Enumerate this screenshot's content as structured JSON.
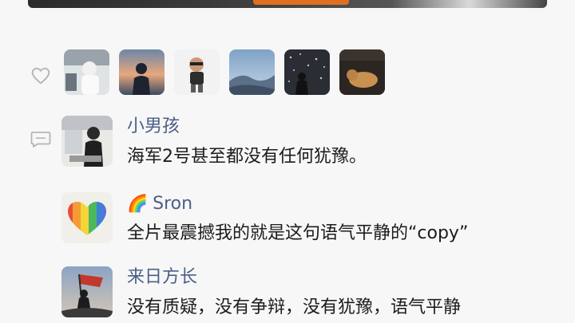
{
  "likes": {
    "icon": "heart-outline-icon",
    "avatars": [
      {
        "name": "liker-avatar-1"
      },
      {
        "name": "liker-avatar-2"
      },
      {
        "name": "liker-avatar-3"
      },
      {
        "name": "liker-avatar-4"
      },
      {
        "name": "liker-avatar-5"
      },
      {
        "name": "liker-avatar-6"
      }
    ]
  },
  "comments_icon": "comment-bubble-icon",
  "comments": [
    {
      "user": "小男孩",
      "text": "海军2号甚至都没有任何犹豫。"
    },
    {
      "user_emoji": "🌈",
      "user": "Sron",
      "text": "全片最震撼我的就是这句语气平静的“copy”"
    },
    {
      "user": "来日方长",
      "text": "没有质疑，没有争辩，没有犹豫，语气平静"
    }
  ],
  "colors": {
    "username": "#4a5f86",
    "text": "#1c1c1c",
    "background": "#f7f7f7",
    "icon": "#b5b5b5"
  }
}
